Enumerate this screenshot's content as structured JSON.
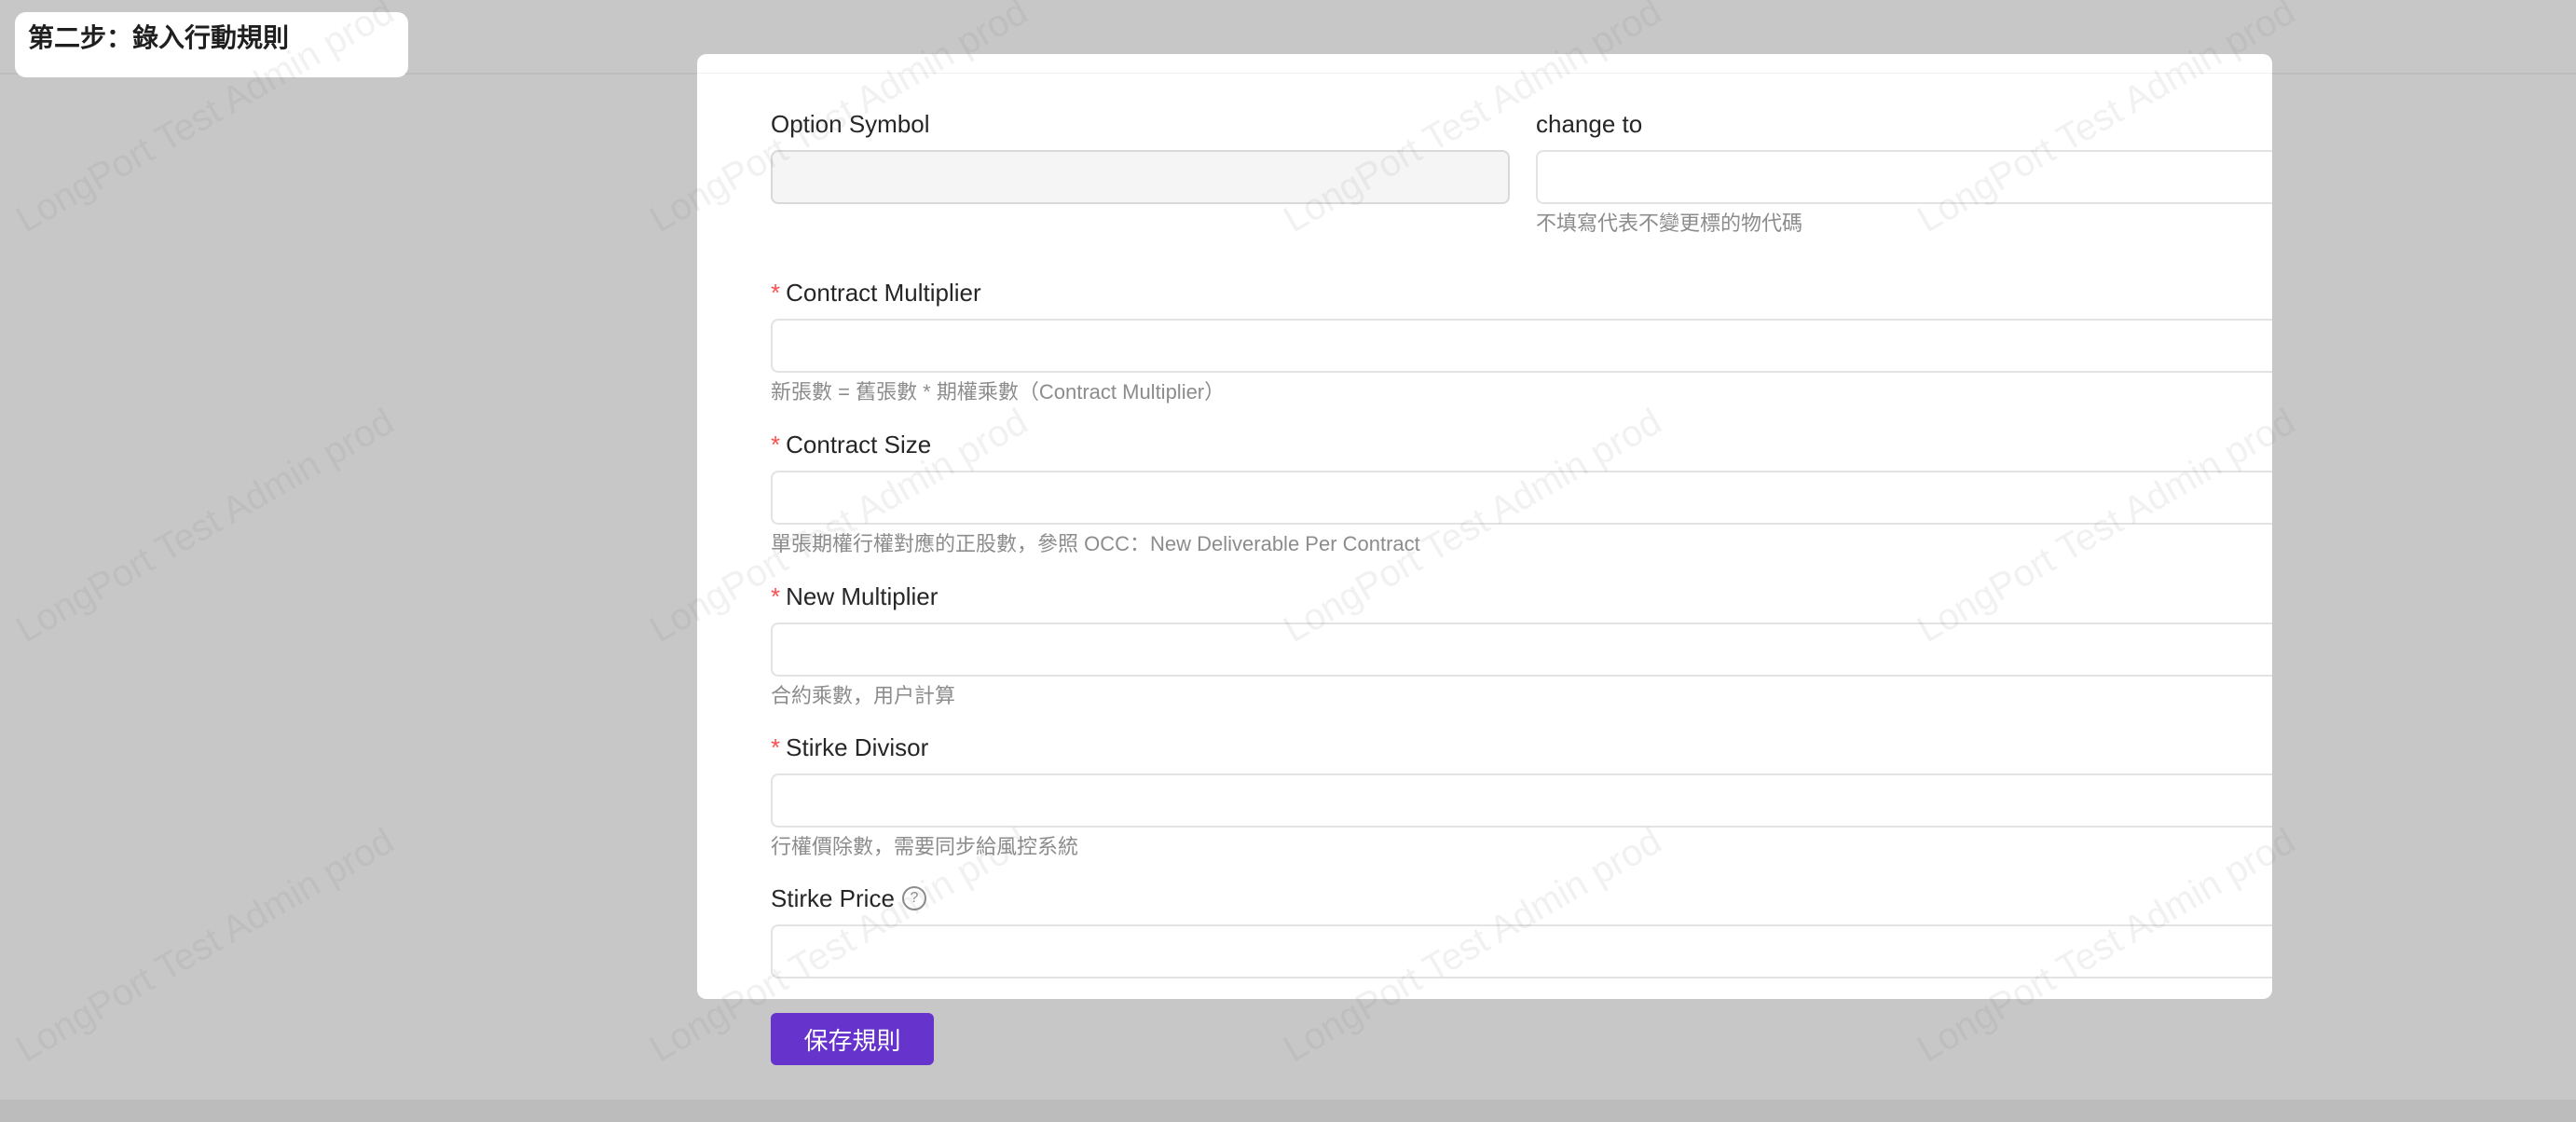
{
  "step": {
    "title": "第二步：錄入行動規則"
  },
  "watermark": {
    "text": "LongPort Test Admin prod"
  },
  "form": {
    "option_symbol": {
      "label": "Option Symbol",
      "value": ""
    },
    "change_to": {
      "label": "change to",
      "value": "",
      "help": "不填寫代表不變更標的物代碼"
    },
    "contract_multiplier": {
      "required_mark": "*",
      "label": "Contract Multiplier",
      "value": "",
      "help": "新張數 = 舊張數 * 期權乘數（Contract Multiplier）"
    },
    "contract_size": {
      "required_mark": "*",
      "label": "Contract Size",
      "value": "",
      "help": "單張期權行權對應的正股數，參照 OCC：New Deliverable Per Contract"
    },
    "new_multiplier": {
      "required_mark": "*",
      "label": "New Multiplier",
      "value": "",
      "help": "合約乘數，用户計算"
    },
    "strike_divisor": {
      "required_mark": "*",
      "label": "Stirke Divisor",
      "value": "",
      "help": "行權價除數，需要同步給風控系統"
    },
    "strike_price": {
      "label": "Stirke Price",
      "tooltip_icon": "question-circle-icon",
      "value": ""
    }
  },
  "actions": {
    "save_label": "保存規則"
  },
  "colors": {
    "primary": "#6633cc",
    "required": "#ff4d4f",
    "background": "#c7c7c7"
  }
}
